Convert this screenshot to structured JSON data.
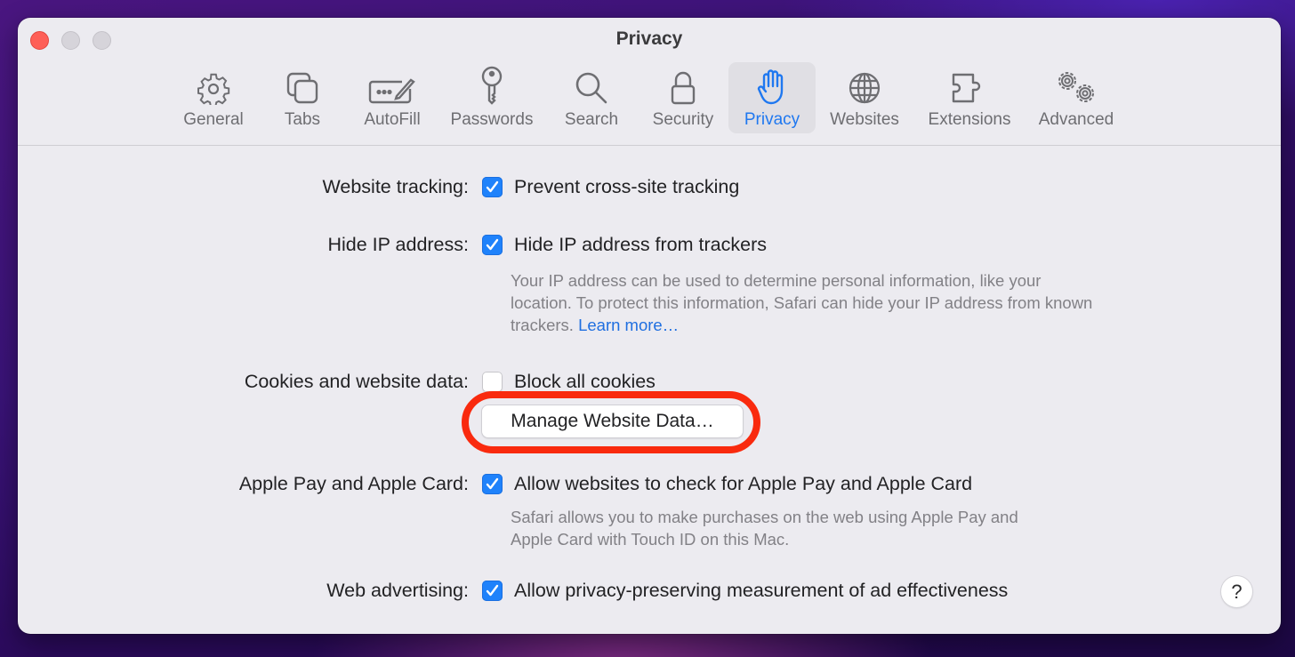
{
  "window": {
    "title": "Privacy",
    "traffic_lights": [
      "close",
      "minimize",
      "zoom"
    ]
  },
  "toolbar": {
    "tabs": [
      {
        "label": "General",
        "icon": "gear-icon",
        "active": false
      },
      {
        "label": "Tabs",
        "icon": "tabs-icon",
        "active": false
      },
      {
        "label": "AutoFill",
        "icon": "autofill-icon",
        "active": false
      },
      {
        "label": "Passwords",
        "icon": "key-icon",
        "active": false
      },
      {
        "label": "Search",
        "icon": "magnifier-icon",
        "active": false
      },
      {
        "label": "Security",
        "icon": "lock-icon",
        "active": false
      },
      {
        "label": "Privacy",
        "icon": "hand-icon",
        "active": true
      },
      {
        "label": "Websites",
        "icon": "globe-icon",
        "active": false
      },
      {
        "label": "Extensions",
        "icon": "puzzle-icon",
        "active": false
      },
      {
        "label": "Advanced",
        "icon": "gears-icon",
        "active": false
      }
    ]
  },
  "settings": {
    "website_tracking": {
      "label": "Website tracking:",
      "option": "Prevent cross-site tracking",
      "checked": true
    },
    "hide_ip": {
      "label": "Hide IP address:",
      "option": "Hide IP address from trackers",
      "checked": true,
      "description": "Your IP address can be used to determine personal information, like your location. To protect this information, Safari can hide your IP address from known trackers.",
      "link": "Learn more…"
    },
    "cookies": {
      "label": "Cookies and website data:",
      "option": "Block all cookies",
      "checked": false,
      "button": "Manage Website Data…"
    },
    "apple_pay": {
      "label": "Apple Pay and Apple Card:",
      "option": "Allow websites to check for Apple Pay and Apple Card",
      "checked": true,
      "description": "Safari allows you to make purchases on the web using Apple Pay and Apple Card with Touch ID on this Mac."
    },
    "web_advertising": {
      "label": "Web advertising:",
      "option": "Allow privacy-preserving measurement of ad effectiveness",
      "checked": true
    }
  },
  "help_button": "?",
  "colors": {
    "accent": "#1f82fb",
    "annotation": "#f92a0e",
    "window_bg": "#ecebf0"
  }
}
